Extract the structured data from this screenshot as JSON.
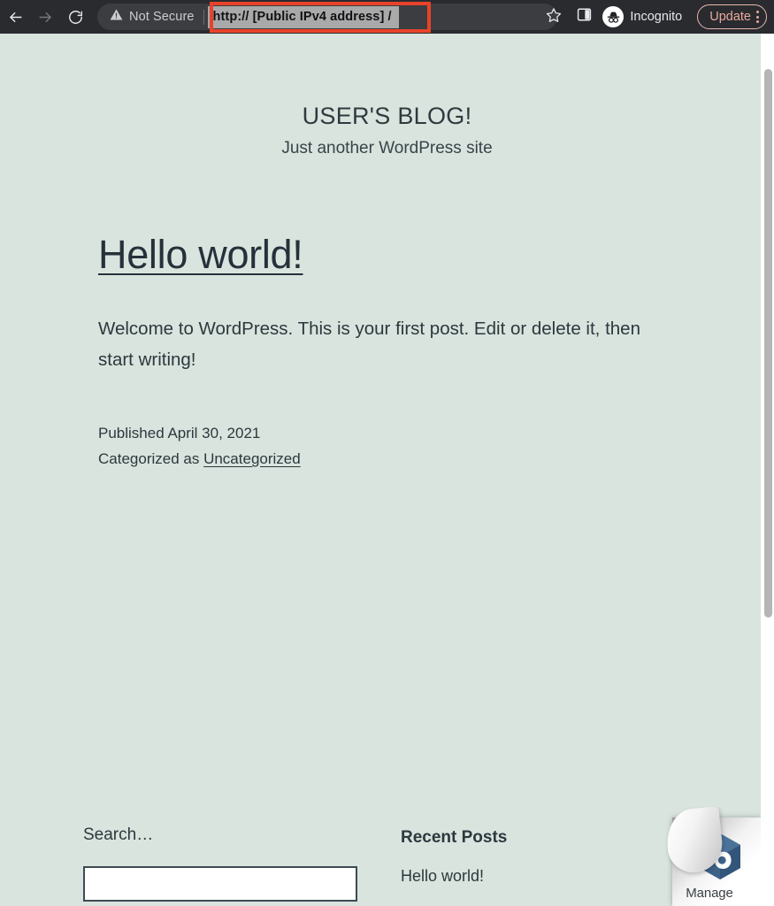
{
  "browser": {
    "back_icon": "back-arrow-icon",
    "forward_icon": "forward-arrow-icon",
    "reload_icon": "reload-icon",
    "security_status": "Not Secure",
    "security_icon": "warning-triangle-icon",
    "url": "http:// [Public IPv4 address] /",
    "url_selected": true,
    "bookmark_icon": "star-icon",
    "side_panel_icon": "side-panel-icon",
    "profile_name": "Incognito",
    "profile_icon": "incognito-icon",
    "update_label": "Update",
    "menu_icon": "kebab-menu-icon",
    "annotation_color": "#e8432a",
    "toolbar_bg": "#292b2f",
    "omnibox_bg": "#3b3d41",
    "selection_bg": "#a9a9a9"
  },
  "page": {
    "background_color": "#d8e4dd",
    "text_color": "#2d383e",
    "site_title": "USER'S BLOG!",
    "site_tagline": "Just another WordPress site",
    "post": {
      "title": "Hello world!",
      "body": "Welcome to WordPress. This is your first post. Edit or delete it, then start writing!",
      "published": "Published April 30, 2021",
      "categorized_prefix": "Categorized as ",
      "category": "Uncategorized"
    },
    "footer": {
      "search_label": "Search…",
      "search_value": "",
      "search_placeholder": "",
      "recent_posts_title": "Recent Posts",
      "recent_posts": [
        {
          "label": "Hello world!"
        }
      ]
    },
    "manage_banner": {
      "label": "Manage",
      "logo_icon": "bitnami-logo-icon",
      "logo_color": "#3d6389"
    }
  }
}
